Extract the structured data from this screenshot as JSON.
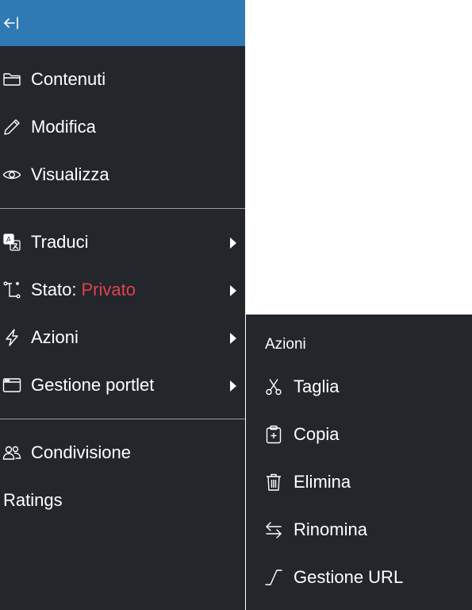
{
  "colors": {
    "toolbar_bg": "#23262b",
    "toolbar_top_bg": "#2f7ab5",
    "state_private": "#e0424f",
    "text": "#ffffff"
  },
  "toolbar": {
    "collapse_icon": "collapse-left-icon",
    "items": [
      {
        "label": "Contenuti",
        "icon": "folder-icon"
      },
      {
        "label": "Modifica",
        "icon": "pencil-icon"
      },
      {
        "label": "Visualizza",
        "icon": "eye-icon"
      },
      {
        "label": "Traduci",
        "icon": "translate-icon",
        "has_submenu": true
      },
      {
        "label": "Stato:",
        "value": "Privato",
        "icon": "workflow-icon",
        "has_submenu": true
      },
      {
        "label": "Azioni",
        "icon": "lightning-icon",
        "has_submenu": true
      },
      {
        "label": "Gestione portlet",
        "icon": "window-icon",
        "has_submenu": true
      },
      {
        "label": "Condivisione",
        "icon": "people-icon"
      },
      {
        "label": "Ratings"
      }
    ]
  },
  "submenu": {
    "title": "Azioni",
    "items": [
      {
        "label": "Taglia",
        "icon": "scissors-icon"
      },
      {
        "label": "Copia",
        "icon": "clipboard-plus-icon"
      },
      {
        "label": "Elimina",
        "icon": "trash-icon"
      },
      {
        "label": "Rinomina",
        "icon": "arrow-left-right-icon"
      },
      {
        "label": "Gestione URL",
        "icon": "url-slope-icon"
      }
    ]
  }
}
